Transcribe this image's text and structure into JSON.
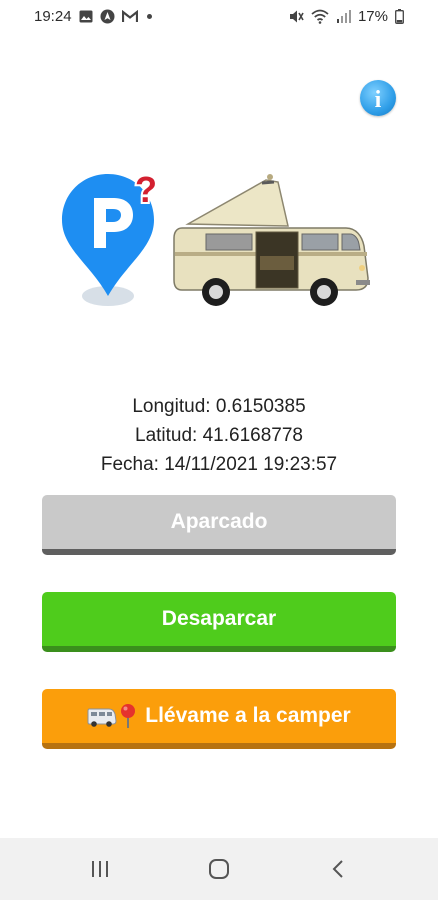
{
  "status_bar": {
    "time": "19:24",
    "battery": "17%",
    "icons_left": [
      "image-icon",
      "nav-icon",
      "gmail-icon",
      "dot-icon"
    ],
    "icons_right": [
      "mute-icon",
      "wifi-icon",
      "signal-icon",
      "battery-icon"
    ]
  },
  "info_button": {
    "icon": "info-icon",
    "glyph": "i"
  },
  "location": {
    "longitude_text": "Longitud: 0.6150385",
    "latitude_text": "Latitud: 41.6168778",
    "date_text": "Fecha: 14/11/2021 19:23:57"
  },
  "buttons": {
    "parked_label": "Aparcado",
    "unpark_label": "Desaparcar",
    "take_me_label": "Llévame a la camper",
    "take_me_emoji_van": "🚐",
    "take_me_emoji_pin": "📍"
  },
  "colors": {
    "parked_bg": "#c9c9c9",
    "unpark_bg": "#4fcc1c",
    "take_me_bg": "#fb9e0b",
    "info_blue": "#2f9ee8",
    "parking_pin_blue": "#1e8ef2"
  },
  "nav_bar": {
    "items": [
      "recents-icon",
      "home-icon",
      "back-icon"
    ]
  }
}
